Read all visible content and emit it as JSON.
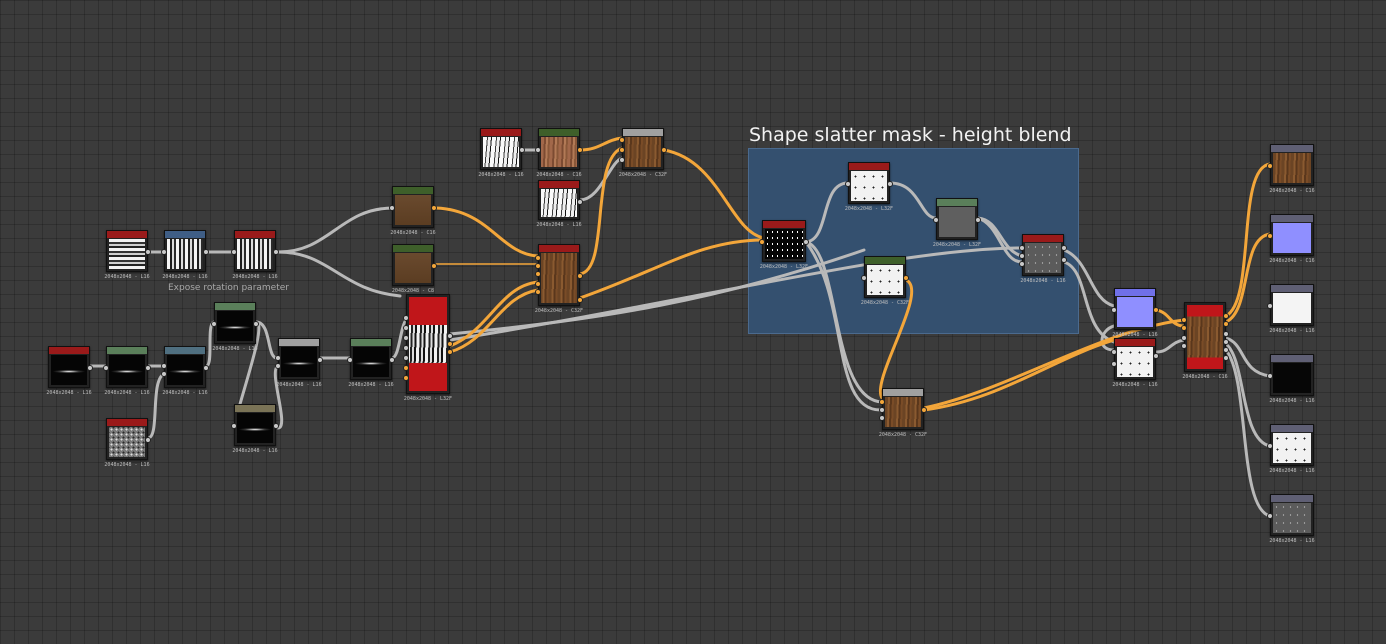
{
  "frame": {
    "title": "Shape slatter mask - height blend",
    "caption": "Expose rotation parameter"
  },
  "colors": {
    "background": "#3b3b3b",
    "frame_fill": "#34506f",
    "wire_gray": "#b9b9b9",
    "wire_orange": "#f3a63a"
  },
  "nodes": [
    {
      "id": "n01",
      "label": "2048x2048 - L16",
      "header": "#9a1a1a",
      "thumb": "stripes"
    },
    {
      "id": "n02",
      "label": "2048x2048 - L16",
      "header": "#3f5e86",
      "thumb": "stripes"
    },
    {
      "id": "n03",
      "label": "2048x2048 - L16",
      "header": "#9a1a1a",
      "thumb": "stripes"
    },
    {
      "id": "n04",
      "label": "2048x2048 - L16",
      "header": "#9a1a1a",
      "thumb": "blackline"
    },
    {
      "id": "n05",
      "label": "2048x2048 - L16",
      "header": "#5a7f5a",
      "thumb": "blackline"
    },
    {
      "id": "n06",
      "label": "2048x2048 - L16",
      "header": "#4f6f80",
      "thumb": "blackline"
    },
    {
      "id": "n07",
      "label": "2048x2048 - L16",
      "header": "#9a1a1a",
      "thumb": "noise"
    },
    {
      "id": "n08",
      "label": "2048x2048 - L16",
      "header": "#5a7f5a",
      "thumb": "blackline"
    },
    {
      "id": "n09",
      "label": "2048x2048 - L16",
      "header": "#7a7356",
      "thumb": "blackline"
    },
    {
      "id": "n10",
      "label": "2048x2048 - L16",
      "header": "#a0a0a0",
      "thumb": "blackline"
    },
    {
      "id": "n11",
      "label": "2048x2048 - L16",
      "header": "#5a7f5a",
      "thumb": "blackline"
    },
    {
      "id": "n12",
      "label": "2048x2048 - L32F",
      "header": "#9a1a1a",
      "thumb": "redwhite"
    },
    {
      "id": "n13",
      "label": "2048x2048 - C16",
      "header": "#3e5f2a",
      "thumb": "woodbrown"
    },
    {
      "id": "n14",
      "label": "2048x2048 - C8",
      "header": "#3e5f2a",
      "thumb": "woodbrown"
    },
    {
      "id": "n15",
      "label": "2048x2048 - L16",
      "header": "#9a1a1a",
      "thumb": "whitefibers"
    },
    {
      "id": "n16",
      "label": "2048x2048 - C16",
      "header": "#3e5f2a",
      "thumb": "woodlight"
    },
    {
      "id": "n17",
      "label": "2048x2048 - L16",
      "header": "#9a1a1a",
      "thumb": "whitefibers"
    },
    {
      "id": "n18",
      "label": "2048x2048 - C32F",
      "header": "#a0a0a0",
      "thumb": "wood"
    },
    {
      "id": "n19",
      "label": "2048x2048 - C32F",
      "header": "#9a1a1a",
      "thumb": "wood"
    },
    {
      "id": "n20",
      "label": "2048x2048 - L32F",
      "header": "#9a1a1a",
      "thumb": "stars"
    },
    {
      "id": "n21",
      "label": "2048x2048 - L32F",
      "header": "#9a1a1a",
      "thumb": "whitedots"
    },
    {
      "id": "n22",
      "label": "2048x2048 - L32F",
      "header": "#5a7f5a",
      "thumb": "gray"
    },
    {
      "id": "n23",
      "label": "2048x2048 - L16",
      "header": "#9a1a1a",
      "thumb": "graydots"
    },
    {
      "id": "n24",
      "label": "2048x2048 - C32F",
      "header": "#3e5f2a",
      "thumb": "whitedots"
    },
    {
      "id": "n25",
      "label": "2048x2048 - C32F",
      "header": "#a0a0a0",
      "thumb": "wood"
    },
    {
      "id": "n26",
      "label": "2048x2048 - L16",
      "header": "#7070e8",
      "thumb": "purple"
    },
    {
      "id": "n27",
      "label": "2048x2048 - L16",
      "header": "#9a1a1a",
      "thumb": "whitedots"
    },
    {
      "id": "n28",
      "label": "2048x2048 - C16",
      "header": "#9a1a1a",
      "thumb": "redwood"
    },
    {
      "id": "n29",
      "label": "2048x2048 - C16",
      "header": "#5f5f74",
      "thumb": "wood"
    },
    {
      "id": "n30",
      "label": "2048x2048 - C16",
      "header": "#5f5f74",
      "thumb": "purple"
    },
    {
      "id": "n31",
      "label": "2048x2048 - L16",
      "header": "#5f5f74",
      "thumb": "white"
    },
    {
      "id": "n32",
      "label": "2048x2048 - L16",
      "header": "#5f5f74",
      "thumb": "black"
    },
    {
      "id": "n33",
      "label": "2048x2048 - L16",
      "header": "#5f5f74",
      "thumb": "whitedots"
    },
    {
      "id": "n34",
      "label": "2048x2048 - L16",
      "header": "#5f5f74",
      "thumb": "graydots"
    }
  ]
}
